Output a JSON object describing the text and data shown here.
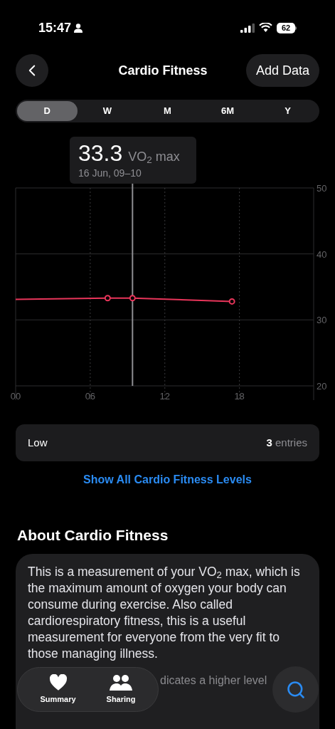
{
  "status_bar": {
    "time": "15:47",
    "battery": "62"
  },
  "nav": {
    "title": "Cardio Fitness",
    "action": "Add Data"
  },
  "ranges": [
    {
      "label": "D",
      "selected": true
    },
    {
      "label": "W",
      "selected": false
    },
    {
      "label": "M",
      "selected": false
    },
    {
      "label": "6M",
      "selected": false
    },
    {
      "label": "Y",
      "selected": false
    }
  ],
  "tooltip": {
    "value": "33.3",
    "unit": "VO$_{2}$ max",
    "date": "16 Jun, 09–10"
  },
  "chart": {
    "chart_data": {
      "type": "line",
      "x": [
        0,
        7.4,
        9.4,
        17.4
      ],
      "series": [
        {
          "color": "#e8355a",
          "values": [
            33.1,
            33.3,
            33.3,
            32.8
          ]
        }
      ],
      "xlim": [
        0,
        24
      ],
      "ylim": [
        20,
        50
      ],
      "xticks": [
        {
          "value": 0,
          "label": "00"
        },
        {
          "value": 6,
          "label": "06"
        },
        {
          "value": 12,
          "label": "12"
        },
        {
          "value": 18,
          "label": "18"
        }
      ],
      "yticks": [
        20,
        30,
        40,
        50
      ],
      "grid": true,
      "ref_lines": [
        {
          "axis": "x",
          "value": 9.4
        }
      ]
    }
  },
  "summary_row": {
    "label": "Low",
    "count": "3",
    "unit": "entries"
  },
  "link": "Show All Cardio Fitness Levels",
  "about": {
    "heading": "About Cardio Fitness",
    "text": "This is a measurement of your VO$_{2}$ max, which is the maximum amount of oxygen your body can consume during exercise. Also called cardiorespiratory fitness, this is a useful measurement for everyone from the very fit to those managing illness.",
    "faded_text": "dicates a higher level"
  },
  "tab_bar": [
    {
      "label": "Summary",
      "kind": "heart"
    },
    {
      "label": "Sharing",
      "kind": "people"
    }
  ]
}
